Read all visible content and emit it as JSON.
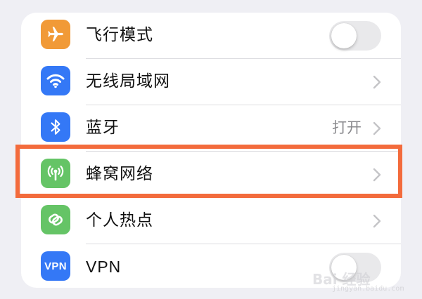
{
  "settings": {
    "rows": [
      {
        "id": "airplane",
        "label": "飞行模式",
        "icon": "airplane-icon",
        "icon_color": "#f19a37",
        "control": "toggle",
        "toggle_on": false
      },
      {
        "id": "wlan",
        "label": "无线局域网",
        "icon": "wifi-icon",
        "icon_color": "#3478f6",
        "control": "chevron"
      },
      {
        "id": "bluetooth",
        "label": "蓝牙",
        "value": "打开",
        "icon": "bluetooth-icon",
        "icon_color": "#3478f6",
        "control": "chevron"
      },
      {
        "id": "cellular",
        "label": "蜂窝网络",
        "icon": "antenna-icon",
        "icon_color": "#65c466",
        "control": "chevron",
        "highlighted": true
      },
      {
        "id": "hotspot",
        "label": "个人热点",
        "icon": "hotspot-link-icon",
        "icon_color": "#65c466",
        "control": "chevron"
      },
      {
        "id": "vpn",
        "label": "VPN",
        "icon_text": "VPN",
        "icon": "vpn-icon",
        "icon_color": "#3478f6",
        "control": "toggle",
        "toggle_on": false
      }
    ]
  },
  "highlight_color": "#f36b3c",
  "watermark": {
    "main": "Bai  经验",
    "sub": "jingyan.baidu.com"
  }
}
